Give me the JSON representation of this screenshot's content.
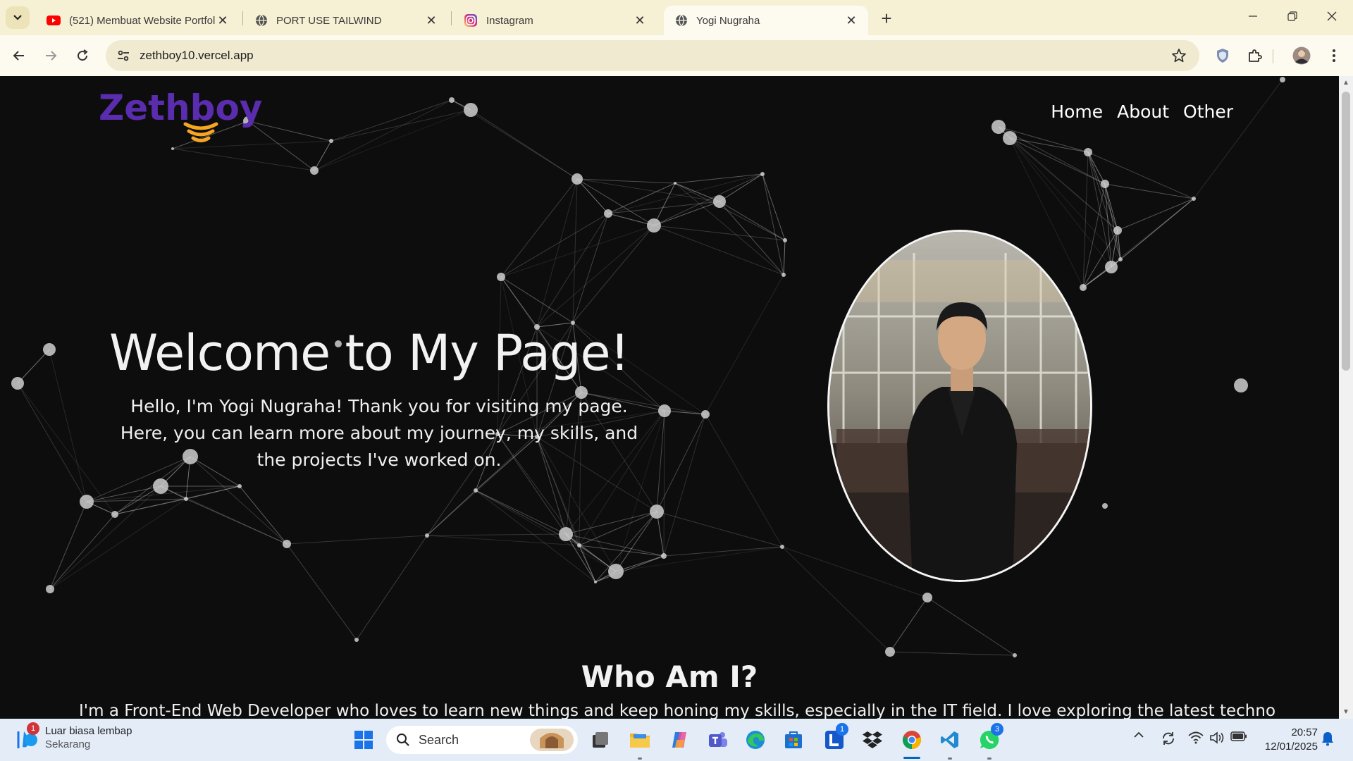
{
  "browser": {
    "tabs": [
      {
        "title": "(521) Membuat Website Portfol",
        "icon": "youtube-icon",
        "active": false
      },
      {
        "title": "PORT USE TAILWIND",
        "icon": "globe-icon",
        "active": false
      },
      {
        "title": "Instagram",
        "icon": "instagram-icon",
        "active": false
      },
      {
        "title": "Yogi Nugraha",
        "icon": "globe-icon",
        "active": true
      }
    ],
    "url": "zethboy10.vercel.app"
  },
  "page": {
    "logo_text": "Zethboy",
    "nav": [
      "Home",
      "About",
      "Other"
    ],
    "hero_title": "Welcome to My Page!",
    "hero_subtitle": "Hello, I'm Yogi Nugraha! Thank you for visiting my page. Here, you can learn more about my journey, my skills, and the projects I've worked on.",
    "section_title": "Who Am I?",
    "section_text": "I'm a Front-End Web Developer who loves to learn new things and keep honing my skills, especially in the IT field. I love exploring the latest technology",
    "colors": {
      "logo": "#5a2cae",
      "logo_waves": "#f5a623",
      "background": "#0d0d0d"
    }
  },
  "taskbar": {
    "notification_title": "Luar biasa lembap",
    "notification_sub": "Sekarang",
    "notification_count": "1",
    "search_label": "Search",
    "mail_badge": "1",
    "whatsapp_badge": "3",
    "time": "20:57",
    "date": "12/01/2025"
  }
}
